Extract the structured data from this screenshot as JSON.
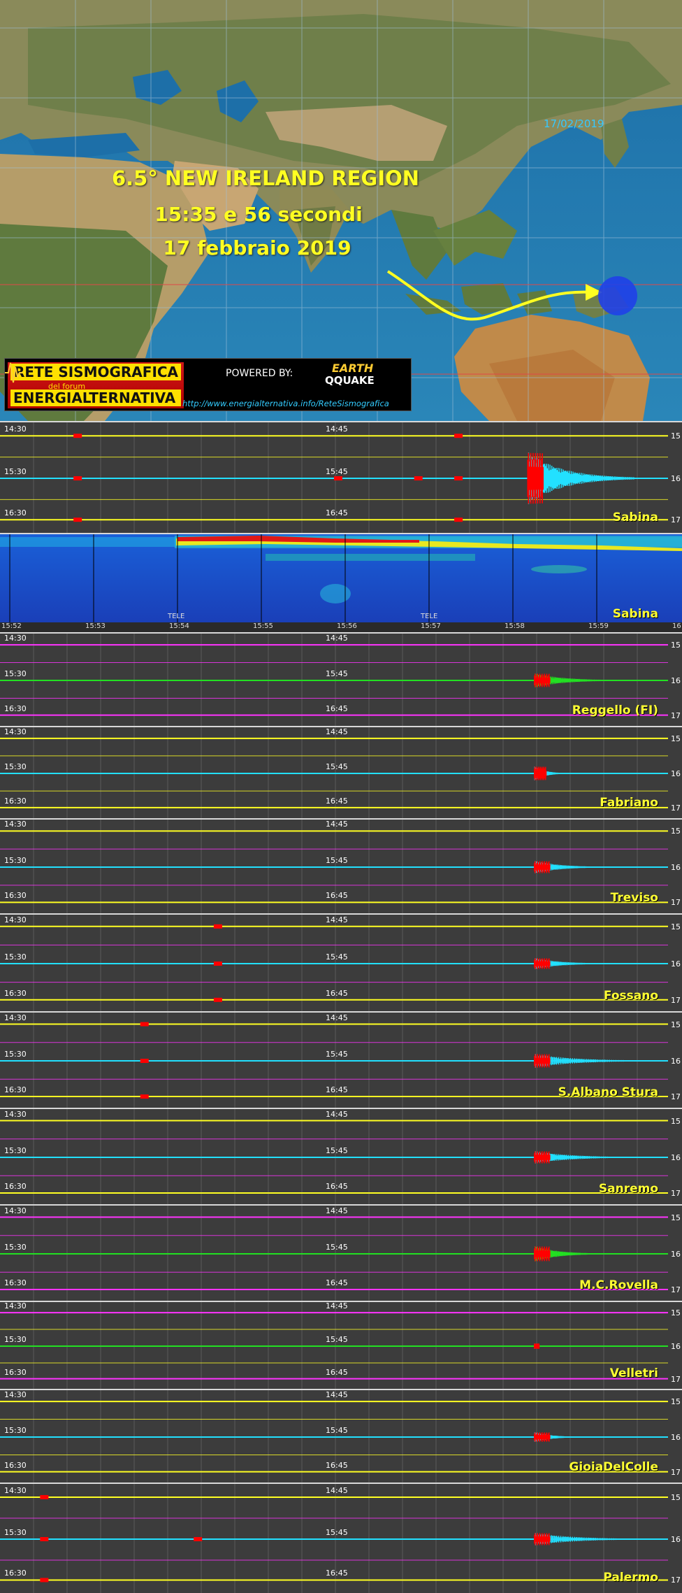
{
  "header": {
    "date_stamp": "17/02/2019",
    "quake_title": "6.5° NEW IRELAND REGION",
    "quake_time": "15:35 e 56 secondi",
    "quake_date": "17 febbraio 2019"
  },
  "logo": {
    "line1": "RETE SISMOGRAFICA",
    "line2": "del forum",
    "line3": "ENERGIALTERNATIVA",
    "powered": "POWERED BY:",
    "brand1": "EARTH",
    "brand2": "QQUAKE",
    "url": "http://www.energialternativa.info/ReteSismografica"
  },
  "colors": {
    "trace_yellow": "#ffff22",
    "trace_cyan": "#22e0ff",
    "trace_green": "#22e022",
    "trace_magenta": "#ff33ff",
    "event_red": "#ff0000",
    "label_yellow": "#ffff33",
    "bg": "#3c3c3c"
  },
  "spectrogram": {
    "station": "Sabina",
    "ticks": [
      "15:52",
      "15:53",
      "15:54",
      "15:55",
      "15:56",
      "15:57",
      "15:58",
      "15:59",
      "16"
    ],
    "tele_labels": [
      "TELE",
      "TELE"
    ]
  },
  "panels": [
    {
      "station": "Sabina",
      "left_times": [
        "14:30",
        "15:30",
        "16:30"
      ],
      "mid_times": [
        "14:45",
        "15:45",
        "16:45"
      ],
      "right_times": [
        "15",
        "16",
        "17"
      ],
      "rows": [
        "yellow",
        "cyan",
        "yellow"
      ],
      "grid": "yellow"
    },
    {
      "station": "Reggello (FI)",
      "left_times": [
        "14:30",
        "15:30",
        "16:30"
      ],
      "mid_times": [
        "14:45",
        "15:45",
        "16:45"
      ],
      "right_times": [
        "15",
        "16",
        "17"
      ],
      "rows": [
        "magenta",
        "green",
        "magenta"
      ],
      "grid": "magenta"
    },
    {
      "station": "Fabriano",
      "left_times": [
        "14:30",
        "15:30",
        "16:30"
      ],
      "mid_times": [
        "14:45",
        "15:45",
        "16:45"
      ],
      "right_times": [
        "15",
        "16",
        "17"
      ],
      "rows": [
        "yellow",
        "cyan",
        "yellow"
      ],
      "grid": "yellow"
    },
    {
      "station": "Treviso",
      "left_times": [
        "14:30",
        "15:30",
        "16:30"
      ],
      "mid_times": [
        "14:45",
        "15:45",
        "16:45"
      ],
      "right_times": [
        "15",
        "16",
        "17"
      ],
      "rows": [
        "yellow",
        "cyan",
        "yellow"
      ],
      "grid": "magenta"
    },
    {
      "station": "Fossano",
      "left_times": [
        "14:30",
        "15:30",
        "16:30"
      ],
      "mid_times": [
        "14:45",
        "15:45",
        "16:45"
      ],
      "right_times": [
        "15",
        "16",
        "17"
      ],
      "rows": [
        "yellow",
        "cyan",
        "yellow"
      ],
      "grid": "magenta"
    },
    {
      "station": "S.Albano Stura",
      "left_times": [
        "14:30",
        "15:30",
        "16:30"
      ],
      "mid_times": [
        "14:45",
        "15:45",
        "16:45"
      ],
      "right_times": [
        "15",
        "16",
        "17"
      ],
      "rows": [
        "yellow",
        "cyan",
        "yellow"
      ],
      "grid": "magenta"
    },
    {
      "station": "Sanremo",
      "left_times": [
        "14:30",
        "15:30",
        "16:30"
      ],
      "mid_times": [
        "14:45",
        "15:45",
        "16:45"
      ],
      "right_times": [
        "15",
        "16",
        "17"
      ],
      "rows": [
        "yellow",
        "cyan",
        "yellow"
      ],
      "grid": "magenta"
    },
    {
      "station": "M.C.Rovella",
      "left_times": [
        "14:30",
        "15:30",
        "16:30"
      ],
      "mid_times": [
        "14:45",
        "15:45",
        "16:45"
      ],
      "right_times": [
        "15",
        "16",
        "17"
      ],
      "rows": [
        "magenta",
        "green",
        "magenta"
      ],
      "grid": "magenta"
    },
    {
      "station": "Velletri",
      "left_times": [
        "14:30",
        "15:30",
        "16:30"
      ],
      "mid_times": [
        "14:45",
        "15:45",
        "16:45"
      ],
      "right_times": [
        "15",
        "16",
        "17"
      ],
      "rows": [
        "magenta",
        "green",
        "magenta"
      ],
      "grid": "yellow"
    },
    {
      "station": "GioiaDelColle",
      "left_times": [
        "14:30",
        "15:30",
        "16:30"
      ],
      "mid_times": [
        "14:45",
        "15:45",
        "16:45"
      ],
      "right_times": [
        "15",
        "16",
        "17"
      ],
      "rows": [
        "yellow",
        "cyan",
        "yellow"
      ],
      "grid": "yellow"
    },
    {
      "station": "Palermo",
      "left_times": [
        "14:30",
        "15:30",
        "16:30"
      ],
      "mid_times": [
        "14:45",
        "15:45",
        "16:45"
      ],
      "right_times": [
        "15",
        "16",
        "17"
      ],
      "rows": [
        "yellow",
        "cyan",
        "yellow"
      ],
      "grid": "magenta"
    }
  ]
}
